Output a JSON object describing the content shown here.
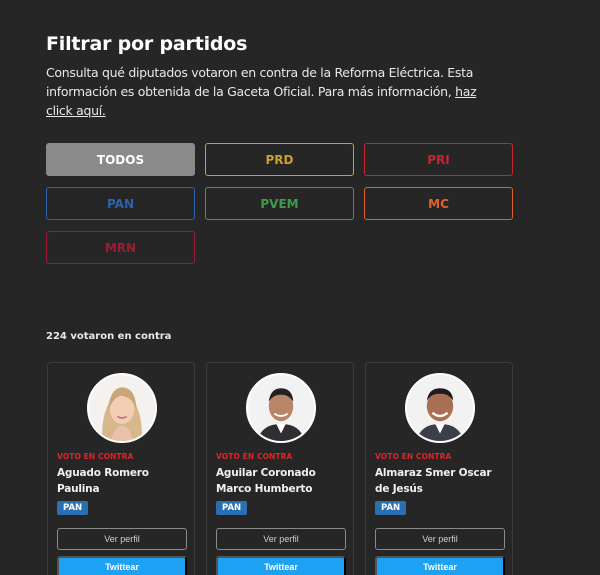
{
  "header": {
    "title": "Filtrar por partidos",
    "description": "Consulta qué diputados votaron en contra de la Reforma Eléctrica. Esta información es obtenida de la Gaceta Oficial. Para más información, ",
    "link_text": "haz click aquí."
  },
  "filters": [
    {
      "label": "TODOS",
      "color": "#ffffff",
      "active": true
    },
    {
      "label": "PRD",
      "color": "#c9a227"
    },
    {
      "label": "PRI",
      "color": "#c8262d"
    },
    {
      "label": "PAN",
      "color": "#2b63b3"
    },
    {
      "label": "PVEM",
      "color": "#3e9b4c"
    },
    {
      "label": "MC",
      "color": "#e0622a"
    },
    {
      "label": "MRN",
      "color": "#9b1c35"
    }
  ],
  "results": {
    "count_text": "224 votaron en contra"
  },
  "cards": [
    {
      "vote": "VOTO EN CONTRA",
      "name": "Aguado Romero Paulina",
      "party": "PAN",
      "profile_label": "Ver perfil",
      "tweet_label": "Twittear"
    },
    {
      "vote": "VOTO EN CONTRA",
      "name": "Aguilar Coronado Marco Humberto",
      "party": "PAN",
      "profile_label": "Ver perfil",
      "tweet_label": "Twittear"
    },
    {
      "vote": "VOTO EN CONTRA",
      "name": "Almaraz Smer Oscar de Jesús",
      "party": "PAN",
      "profile_label": "Ver perfil",
      "tweet_label": "Twittear"
    }
  ]
}
